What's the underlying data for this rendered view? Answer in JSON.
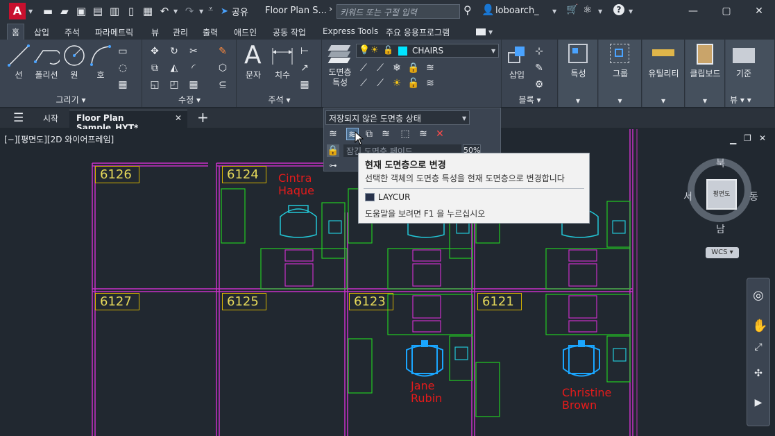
{
  "titlebar": {
    "app_logo": "A",
    "share_label": "공유",
    "document_title": "Floor Plan S...",
    "search_placeholder": "키워드 또는 구절 입력",
    "user_name": "loboarch_"
  },
  "ribbon_tabs": [
    "홈",
    "삽입",
    "주석",
    "파라메트릭",
    "뷰",
    "관리",
    "출력",
    "애드인",
    "공동 작업",
    "Express Tools",
    "주요 응용프로그램"
  ],
  "ribbon": {
    "draw": {
      "title": "그리기",
      "line": "선",
      "polyline": "폴리선",
      "circle": "원",
      "arc": "호"
    },
    "modify": {
      "title": "수정"
    },
    "annotation": {
      "title": "주석",
      "text": "문자",
      "dimension": "치수"
    },
    "layers": {
      "properties": "도면층\n특성",
      "properties_l1": "도면층",
      "properties_l2": "특성",
      "current_layer": "CHAIRS"
    },
    "block": {
      "title": "블록",
      "insert": "삽입"
    },
    "properties": {
      "label": "특성"
    },
    "groups": {
      "label": "그룹"
    },
    "utilities": {
      "label": "유틸리티"
    },
    "clipboard": {
      "label": "클립보드"
    },
    "base": {
      "label": "기준",
      "view_title": "뷰"
    }
  },
  "doc_tabs": {
    "start": "시작",
    "active": "Floor Plan Sample_HYT*"
  },
  "viewport_label": "[−][평면도][2D 와이어프레임]",
  "layer_panel": {
    "state_label": "저장되지 않은 도면층 상태",
    "fade_label": "잠긴 도면층 페이드",
    "fade_value": "50%"
  },
  "tooltip": {
    "title": "현재 도면층으로 변경",
    "description": "선택한 객체의 도면층 특성을 현재 도면층으로 변경합니다",
    "command": "LAYCUR",
    "help": "도움말을 보려면 F1 을 누르십시오"
  },
  "viewcube": {
    "north": "북",
    "south": "남",
    "east": "동",
    "west": "서",
    "face": "평면도",
    "wcs": "WCS"
  },
  "rooms": [
    "6126",
    "6124",
    "6127",
    "6125",
    "6123",
    "6121"
  ],
  "people": [
    {
      "first": "Cintra",
      "last": "Haque"
    },
    {
      "first": "Jane",
      "last": "Rubin"
    },
    {
      "first": "Christine",
      "last": "Brown"
    }
  ],
  "colors": {
    "wall": "#c830c8",
    "furniture": "#22cc22",
    "chair": "#1aa6ff",
    "chair_cyan": "#22c8d8",
    "label_frame": "#d6b400",
    "name_text": "#e41b1b",
    "app_red": "#c8102e",
    "current_layer_swatch": "#00e5ff"
  }
}
